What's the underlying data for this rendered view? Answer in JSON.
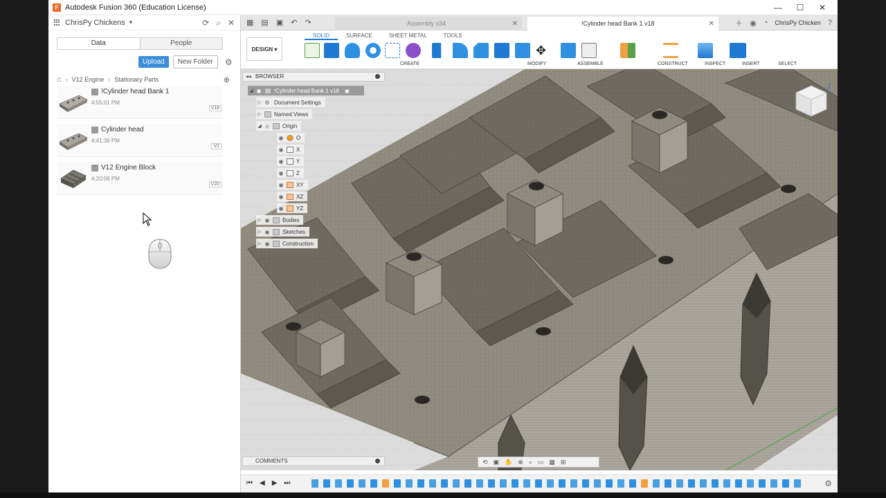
{
  "window": {
    "title": "Autodesk Fusion 360 (Education License)",
    "buttons": [
      "—",
      "☐",
      "✕"
    ]
  },
  "data_panel": {
    "team": "ChrisPy Chickens",
    "tabs": [
      {
        "label": "Data",
        "active": true
      },
      {
        "label": "People",
        "active": false
      }
    ],
    "upload_label": "Upload",
    "new_folder_label": "New Folder",
    "breadcrumb": [
      "V12 Engine",
      "Stationary Parts"
    ],
    "files": [
      {
        "name": "!Cylinder head Bank 1",
        "time": "4:55:01 PM",
        "version": "V18"
      },
      {
        "name": "Cylinder head",
        "time": "4:41:36 PM",
        "version": "V2"
      },
      {
        "name": "V12 Engine Block",
        "time": "4:20:06 PM",
        "version": "V20"
      }
    ]
  },
  "doc_tabs": [
    {
      "label": "Assembly v34",
      "active": false
    },
    {
      "label": "!Cylinder head Bank 1 v18",
      "active": true
    }
  ],
  "user": "ChrisPy Chicken",
  "toolbar": {
    "workspace": "DESIGN",
    "tabs": [
      {
        "label": "SOLID",
        "active": true
      },
      {
        "label": "SURFACE",
        "active": false
      },
      {
        "label": "SHEET METAL",
        "active": false
      },
      {
        "label": "TOOLS",
        "active": false
      }
    ],
    "groups": [
      "CREATE",
      "MODIFY",
      "ASSEMBLE",
      "CONSTRUCT",
      "INSPECT",
      "INSERT",
      "SELECT"
    ]
  },
  "browser": {
    "title": "BROWSER",
    "root": "!Cylinder head Bank 1 v18",
    "nodes": {
      "document_settings": "Document Settings",
      "named_views": "Named Views",
      "origin": "Origin",
      "o": "O",
      "x": "X",
      "y": "Y",
      "z": "Z",
      "xy": "XY",
      "xz": "XZ",
      "yz": "YZ",
      "bodies": "Bodies",
      "sketches": "Sketches",
      "construction": "Construction"
    }
  },
  "comments_label": "COMMENTS",
  "colors": {
    "accent": "#1f78d1",
    "model": "#8f8a7e",
    "upload": "#3a8ed8"
  }
}
